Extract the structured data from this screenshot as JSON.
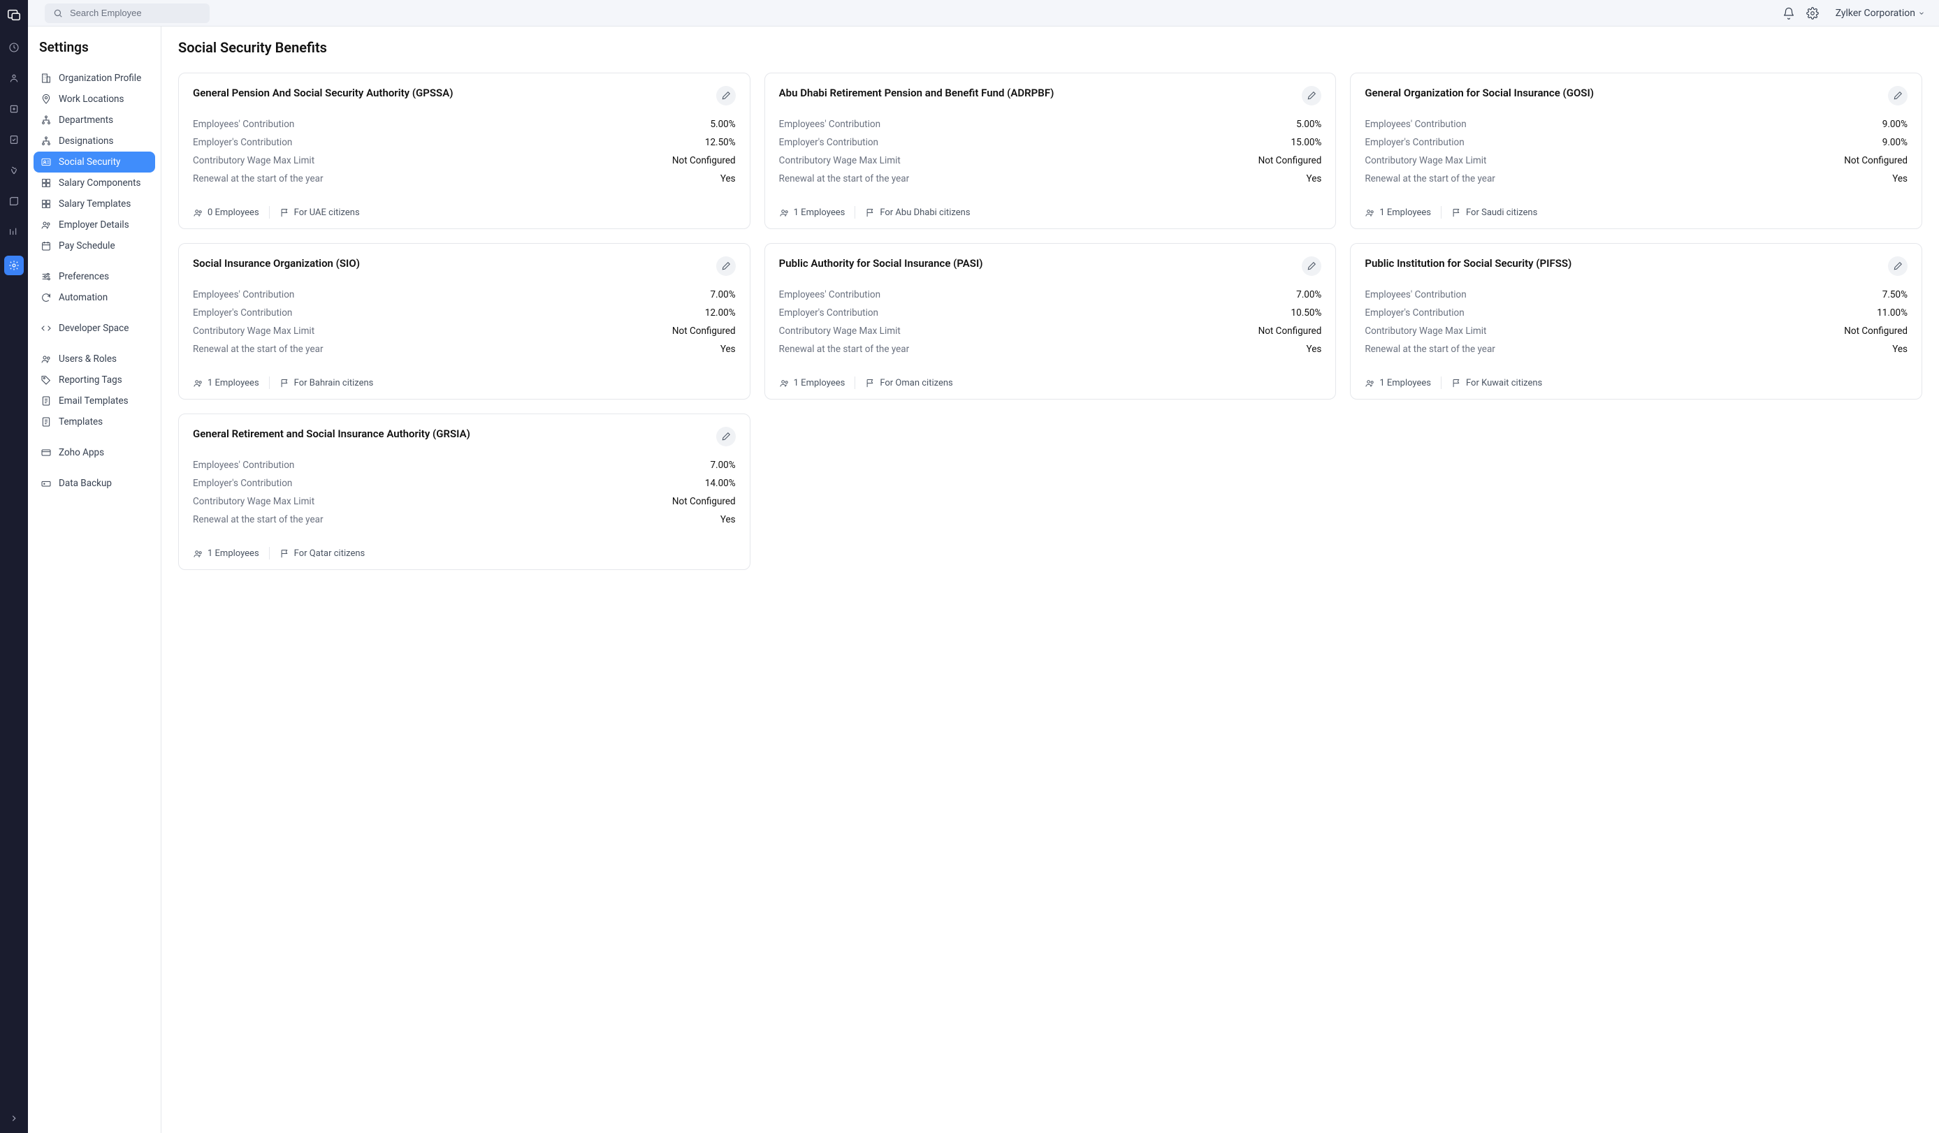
{
  "topbar": {
    "search_placeholder": "Search Employee",
    "org_name": "Zylker Corporation"
  },
  "sidebar": {
    "title": "Settings",
    "items": [
      {
        "label": "Organization Profile"
      },
      {
        "label": "Work Locations"
      },
      {
        "label": "Departments"
      },
      {
        "label": "Designations"
      },
      {
        "label": "Social Security"
      },
      {
        "label": "Salary Components"
      },
      {
        "label": "Salary Templates"
      },
      {
        "label": "Employer Details"
      },
      {
        "label": "Pay Schedule"
      },
      {
        "label": "Preferences"
      },
      {
        "label": "Automation"
      },
      {
        "label": "Developer Space"
      },
      {
        "label": "Users & Roles"
      },
      {
        "label": "Reporting Tags"
      },
      {
        "label": "Email Templates"
      },
      {
        "label": "Templates"
      },
      {
        "label": "Zoho Apps"
      },
      {
        "label": "Data Backup"
      }
    ]
  },
  "page": {
    "title": "Social Security Benefits",
    "row_labels": {
      "emp_contrib": "Employees' Contribution",
      "er_contrib": "Employer's Contribution",
      "wage_max": "Contributory Wage Max Limit",
      "renewal": "Renewal at the start of the year"
    }
  },
  "cards": [
    {
      "title": "General Pension And Social Security Authority (GPSSA)",
      "emp_contrib": "5.00%",
      "er_contrib": "12.50%",
      "wage_max": "Not Configured",
      "renewal": "Yes",
      "employees": "0 Employees",
      "citizens": "For UAE citizens"
    },
    {
      "title": "Abu Dhabi Retirement Pension and Benefit Fund (ADRPBF)",
      "emp_contrib": "5.00%",
      "er_contrib": "15.00%",
      "wage_max": "Not Configured",
      "renewal": "Yes",
      "employees": "1 Employees",
      "citizens": "For Abu Dhabi citizens"
    },
    {
      "title": "General Organization for Social Insurance (GOSI)",
      "emp_contrib": "9.00%",
      "er_contrib": "9.00%",
      "wage_max": "Not Configured",
      "renewal": "Yes",
      "employees": "1 Employees",
      "citizens": "For Saudi citizens"
    },
    {
      "title": "Social Insurance Organization (SIO)",
      "emp_contrib": "7.00%",
      "er_contrib": "12.00%",
      "wage_max": "Not Configured",
      "renewal": "Yes",
      "employees": "1 Employees",
      "citizens": "For Bahrain citizens"
    },
    {
      "title": "Public Authority for Social Insurance (PASI)",
      "emp_contrib": "7.00%",
      "er_contrib": "10.50%",
      "wage_max": "Not Configured",
      "renewal": "Yes",
      "employees": "1 Employees",
      "citizens": "For Oman citizens"
    },
    {
      "title": "Public Institution for Social Security (PIFSS)",
      "emp_contrib": "7.50%",
      "er_contrib": "11.00%",
      "wage_max": "Not Configured",
      "renewal": "Yes",
      "employees": "1 Employees",
      "citizens": "For Kuwait citizens"
    },
    {
      "title": "General Retirement and Social Insurance Authority (GRSIA)",
      "emp_contrib": "7.00%",
      "er_contrib": "14.00%",
      "wage_max": "Not Configured",
      "renewal": "Yes",
      "employees": "1 Employees",
      "citizens": "For Qatar citizens"
    }
  ]
}
